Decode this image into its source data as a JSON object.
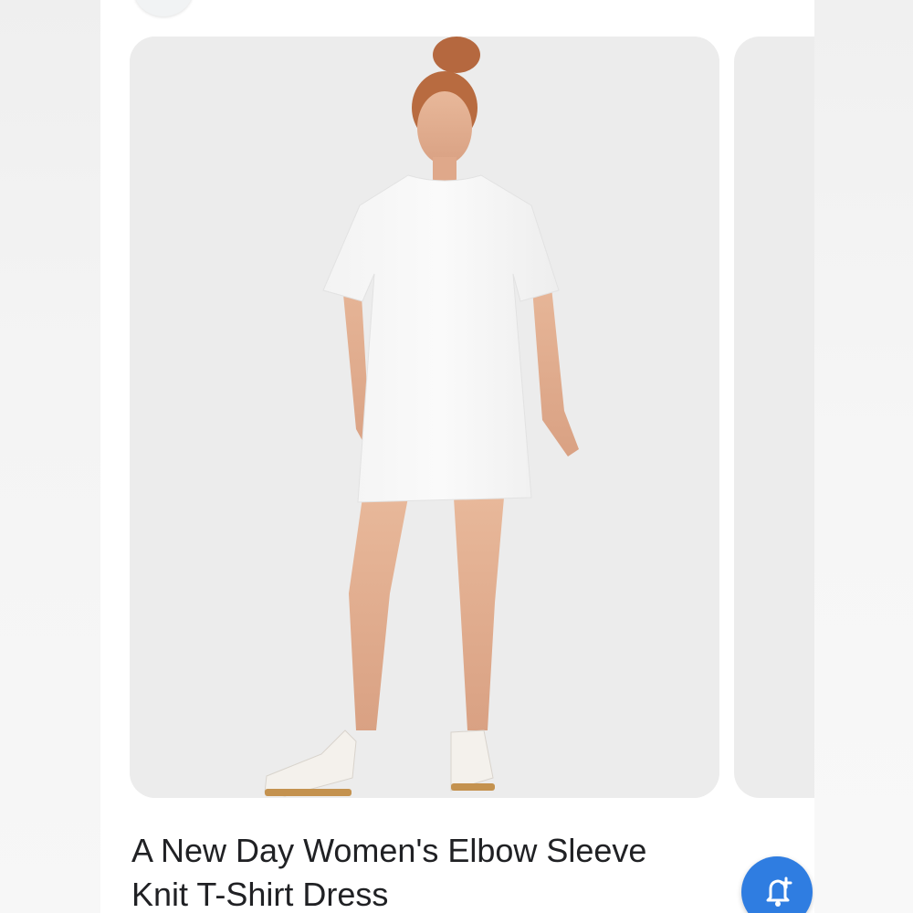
{
  "product": {
    "title_line1": "A New Day Women's Elbow Sleeve",
    "title_line2": "Knit T-Shirt Dress"
  },
  "icons": {
    "back": "arrow-back-icon",
    "top_right": "more-options-icon",
    "alert": "add-alert-icon"
  },
  "colors": {
    "fab": "#2f7de1",
    "image_background": "#ececec",
    "title_text": "#202124"
  }
}
